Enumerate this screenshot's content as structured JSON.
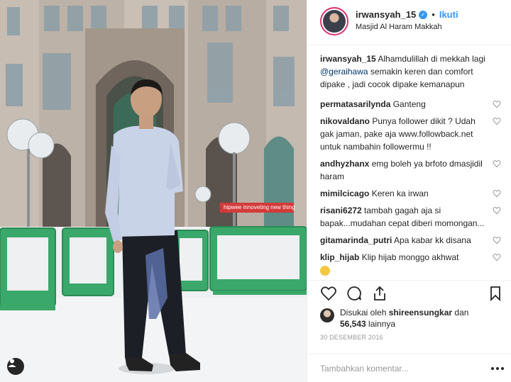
{
  "post": {
    "username": "irwansyah_15",
    "follow_label": "Ikuti",
    "separator": "•",
    "location": "Masjid Al Haram Makkah",
    "watermark": "hipwee innoveting new thing"
  },
  "caption": {
    "author": "irwansyah_15",
    "text_before": " Alhamdulillah di mekkah lagi ",
    "mention": "@geraihawa",
    "text_after": " semakin keren dan comfort dipake , jadi cocok dipake kemanapun"
  },
  "comments": [
    {
      "author": "permatasarilynda",
      "text": " Ganteng"
    },
    {
      "author": "nikovaldano",
      "text": " Punya follower dikit ? Udah gak jaman, pake aja www.followback.net untuk nambahin followermu !!"
    },
    {
      "author": "andhyzhanx",
      "text": " emg boleh ya brfoto dmasjidil haram"
    },
    {
      "author": "mimilcicago",
      "text": " Keren ka irwan"
    },
    {
      "author": "risani6272",
      "text": " tambah gagah aja si bapak...mudahan cepat diberi momongan..."
    },
    {
      "author": "gitamarinda_putri",
      "text": " Apa kabar kk disana"
    },
    {
      "author": "klip_hijab",
      "text": " Klip hijab monggo akhwat"
    }
  ],
  "likes": {
    "prefix": "Disukai oleh ",
    "user": "shireensungkar",
    "middle": " dan",
    "count": "56,543",
    "suffix": " lainnya"
  },
  "date": "30 DESEMBER 2016",
  "comment_input": {
    "placeholder": "Tambahkan komentar..."
  },
  "icons": {
    "verified": "verified-badge-icon",
    "heart": "heart-icon",
    "comment": "comment-icon",
    "share": "share-icon",
    "save": "bookmark-icon",
    "tag": "user-tag-icon",
    "more": "more-options-icon"
  },
  "colors": {
    "accent": "#3897f0",
    "text": "#262626",
    "muted": "#999999",
    "border": "#efefef"
  }
}
